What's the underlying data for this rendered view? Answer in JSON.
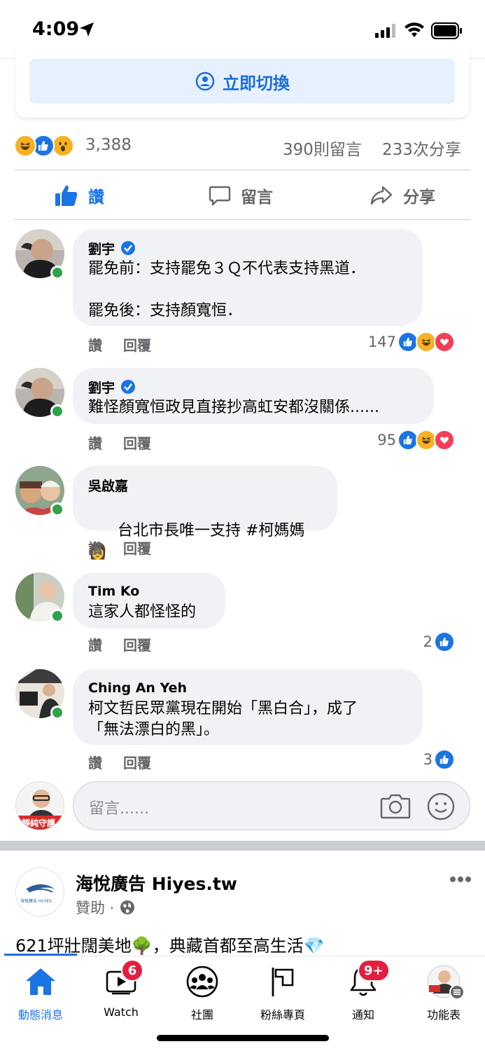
{
  "status_bar": {
    "time": "4:09"
  },
  "switch_button": {
    "label": "立即切換"
  },
  "post_stats": {
    "reaction_count": "3,388",
    "comments": "390則留言",
    "shares": "233次分享"
  },
  "actions": {
    "like": "讚",
    "comment": "留言",
    "share": "分享"
  },
  "comments": [
    {
      "name": "劉宇",
      "verified": true,
      "text": "罷免前：支持罷免３Ｑ不代表支持黑道．\n\n罷免後：支持顏寬恒．",
      "reactions_count": "147",
      "like": "讚",
      "reply": "回覆"
    },
    {
      "name": "劉宇",
      "verified": true,
      "text": "難怪顏寬恒政見直接抄高虹安都沒關係......",
      "reactions_count": "95",
      "like": "讚",
      "reply": "回覆"
    },
    {
      "name": "吳啟嘉",
      "verified": false,
      "text": "台北市長唯一支持 #柯媽媽",
      "emoji": "👩",
      "reactions_count": "",
      "like": "讚",
      "reply": "回覆"
    },
    {
      "name": "Tim Ko",
      "verified": false,
      "text": "這家人都怪怪的",
      "reactions_count": "2",
      "like": "讚",
      "reply": "回覆"
    },
    {
      "name": "Ching An Yeh",
      "verified": false,
      "text": "柯文哲民眾黨現在開始「黑白合」，成了\n「無法漂白的黑」。",
      "reactions_count": "3",
      "like": "讚",
      "reply": "回覆"
    }
  ],
  "composer": {
    "placeholder": "留言......",
    "avatar_text": "靜純守護"
  },
  "sponsored_post": {
    "page_name": "海悅廣告 Hiyes.tw",
    "meta": "贊助 ·",
    "logo_text": "海悅廣告 HI-YES",
    "text": "621坪壯闊美地🌳，典藏首都至高生活💎"
  },
  "tabs": [
    {
      "label": "動態消息",
      "badge": ""
    },
    {
      "label": "Watch",
      "badge": "6"
    },
    {
      "label": "社團",
      "badge": ""
    },
    {
      "label": "粉絲專頁",
      "badge": ""
    },
    {
      "label": "通知",
      "badge": "9+"
    },
    {
      "label": "功能表",
      "badge": ""
    }
  ],
  "colors": {
    "accent": "#1b74e4",
    "online": "#31a24c",
    "badge": "#e41e3f",
    "bubble": "#f0f2f5",
    "secondary_text": "#65676b"
  }
}
